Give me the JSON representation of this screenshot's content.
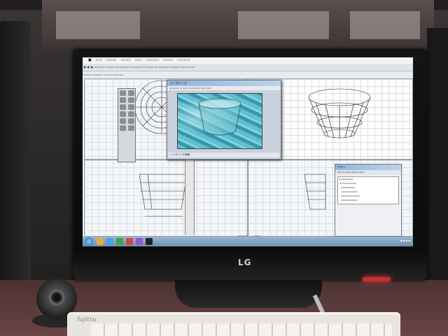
{
  "monitor": {
    "brand": "LG"
  },
  "keyboard": {
    "brand": "fujitsu"
  },
  "screen": {
    "render_window": {
      "title": "レンダリング",
      "status": "レンダリング時間"
    },
    "side_panel": {
      "title": "ツリー"
    },
    "axis_labels": [
      "FRONT",
      "SIDE"
    ]
  }
}
